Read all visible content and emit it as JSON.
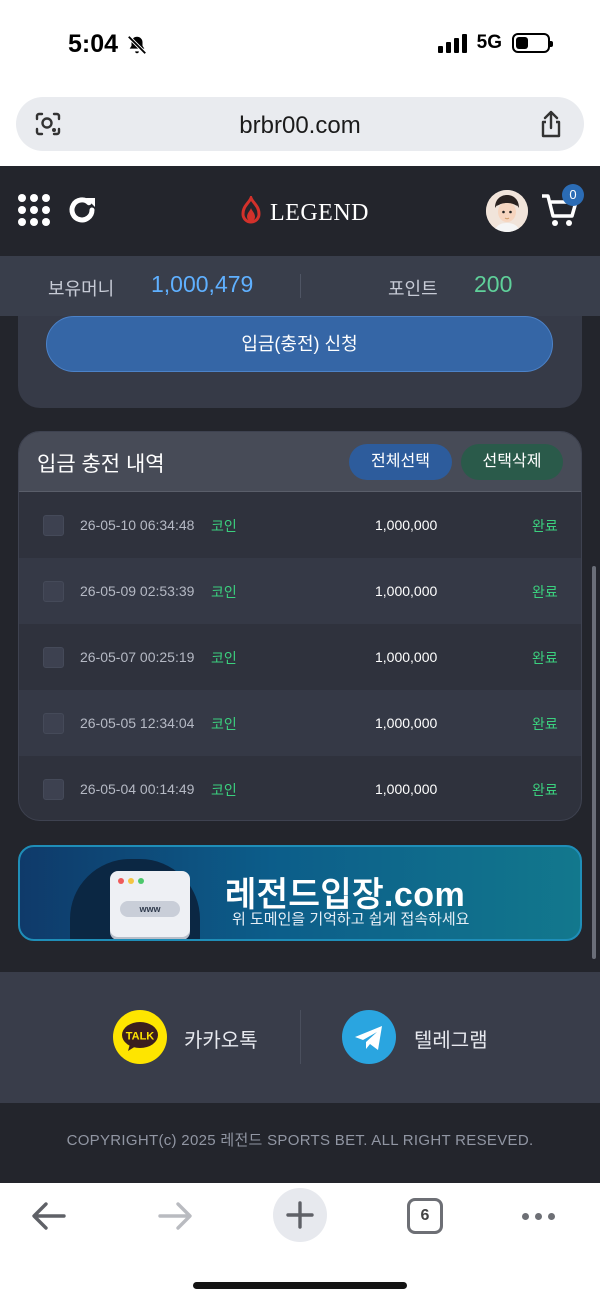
{
  "status_bar": {
    "time": "5:04",
    "network": "5G",
    "silent_icon": "bell-slash-icon",
    "signal_icon": "signal-icon",
    "battery_icon": "battery-icon",
    "battery_level": 0.4
  },
  "browser": {
    "url": "brbr00.com",
    "lens_icon": "visual-search-icon",
    "share_icon": "share-icon"
  },
  "header": {
    "menu_icon": "grid-menu-icon",
    "refresh_icon": "refresh-icon",
    "logo_text": "LEGEND",
    "avatar": "avatar",
    "cart_icon": "cart-icon",
    "cart_count": "0"
  },
  "balance": {
    "money_label": "보유머니",
    "money_value": "1,000,479",
    "point_label": "포인트",
    "point_value": "200"
  },
  "deposit": {
    "apply_label": "입금(충전) 신청"
  },
  "history": {
    "title": "입금 충전 내역",
    "select_all_label": "전체선택",
    "delete_selected_label": "선택삭제",
    "rows": [
      {
        "date": "26-05-10 06:34:48",
        "type": "코인",
        "amount": "1,000,000",
        "status": "완료"
      },
      {
        "date": "26-05-09 02:53:39",
        "type": "코인",
        "amount": "1,000,000",
        "status": "완료"
      },
      {
        "date": "26-05-07 00:25:19",
        "type": "코인",
        "amount": "1,000,000",
        "status": "완료"
      },
      {
        "date": "26-05-05 12:34:04",
        "type": "코인",
        "amount": "1,000,000",
        "status": "완료"
      },
      {
        "date": "26-05-04 00:14:49",
        "type": "코인",
        "amount": "1,000,000",
        "status": "완료"
      }
    ]
  },
  "banner": {
    "www_text": "www",
    "title": "레전드입장.com",
    "subtitle": "위 도메인을 기억하고 쉽게 접속하세요"
  },
  "social": {
    "kakao_badge": "TALK",
    "kakao_label": "카카오톡",
    "telegram_label": "텔레그램"
  },
  "footer": {
    "copyright": "COPYRIGHT(c) 2025 레전드 SPORTS BET. ALL RIGHT RESEVED."
  },
  "toolbar": {
    "tab_count": "6"
  },
  "colors": {
    "accent_blue": "#3566a6",
    "money_blue": "#5fb0ff",
    "point_green": "#5fd09a",
    "status_green": "#3bd07e",
    "kakao_yellow": "#fee500",
    "telegram_blue": "#2aa5e0"
  }
}
